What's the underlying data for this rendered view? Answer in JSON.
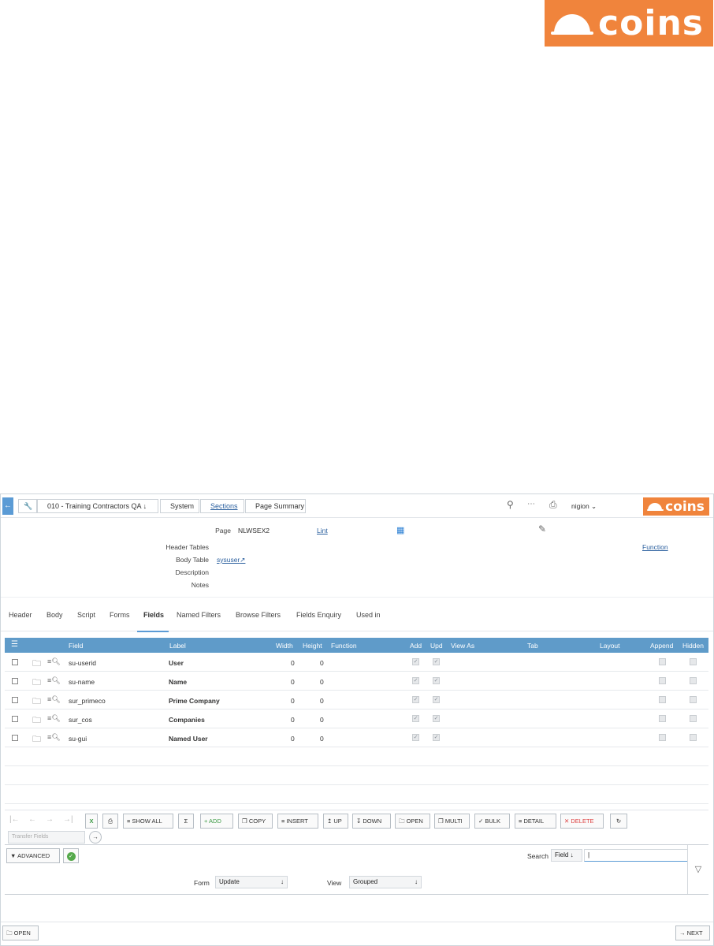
{
  "brand": {
    "name": "coins",
    "color": "#f0843c"
  },
  "topbar": {
    "back_icon": "arrow-left-icon",
    "crumbs": [
      "010 - Training Contractors QA",
      "System",
      "Sections",
      "Page Summary"
    ],
    "user": "nigion"
  },
  "header": {
    "page_label": "Page",
    "page_value": "NLWSEX2",
    "lint_link": "Lint",
    "function_link": "Function",
    "header_tables_label": "Header Tables",
    "body_table_label": "Body Table",
    "body_table_value": "sysuser",
    "description_label": "Description",
    "notes_label": "Notes"
  },
  "tabs": [
    "Header",
    "Body",
    "Script",
    "Forms",
    "Fields",
    "Named Filters",
    "Browse Filters",
    "Fields Enquiry",
    "Used in"
  ],
  "grid": {
    "columns": {
      "field": "Field",
      "label": "Label",
      "width": "Width",
      "height": "Height",
      "function": "Function",
      "add": "Add",
      "upd": "Upd",
      "view_as": "View As",
      "tab": "Tab",
      "layout": "Layout",
      "append": "Append",
      "hidden": "Hidden"
    },
    "rows": [
      {
        "field": "su-userid",
        "label": "User",
        "width": "0",
        "height": "0"
      },
      {
        "field": "su-name",
        "label": "Name",
        "width": "0",
        "height": "0"
      },
      {
        "field": "sur_primeco",
        "label": "Prime Company",
        "width": "0",
        "height": "0"
      },
      {
        "field": "sur_cos",
        "label": "Companies",
        "width": "0",
        "height": "0"
      },
      {
        "field": "su-gui",
        "label": "Named User",
        "width": "0",
        "height": "0"
      }
    ]
  },
  "toolbar": {
    "show_all": "SHOW ALL",
    "sum": "Σ",
    "add": "+ ADD",
    "copy": "COPY",
    "insert": "INSERT",
    "up": "UP",
    "down": "DOWN",
    "open": "OPEN",
    "multi": "MULTI",
    "bulk": "BULK",
    "detail": "DETAIL",
    "delete": "✕ DELETE",
    "transfer_placeholder": "Transfer Fields"
  },
  "search": {
    "advanced": "ADVANCED",
    "search_label": "Search",
    "search_field": "Field",
    "search_value": "|",
    "form_label": "Form",
    "form_value": "Update",
    "view_label": "View",
    "view_value": "Grouped"
  },
  "bottom": {
    "open": "OPEN",
    "next": "NEXT"
  }
}
